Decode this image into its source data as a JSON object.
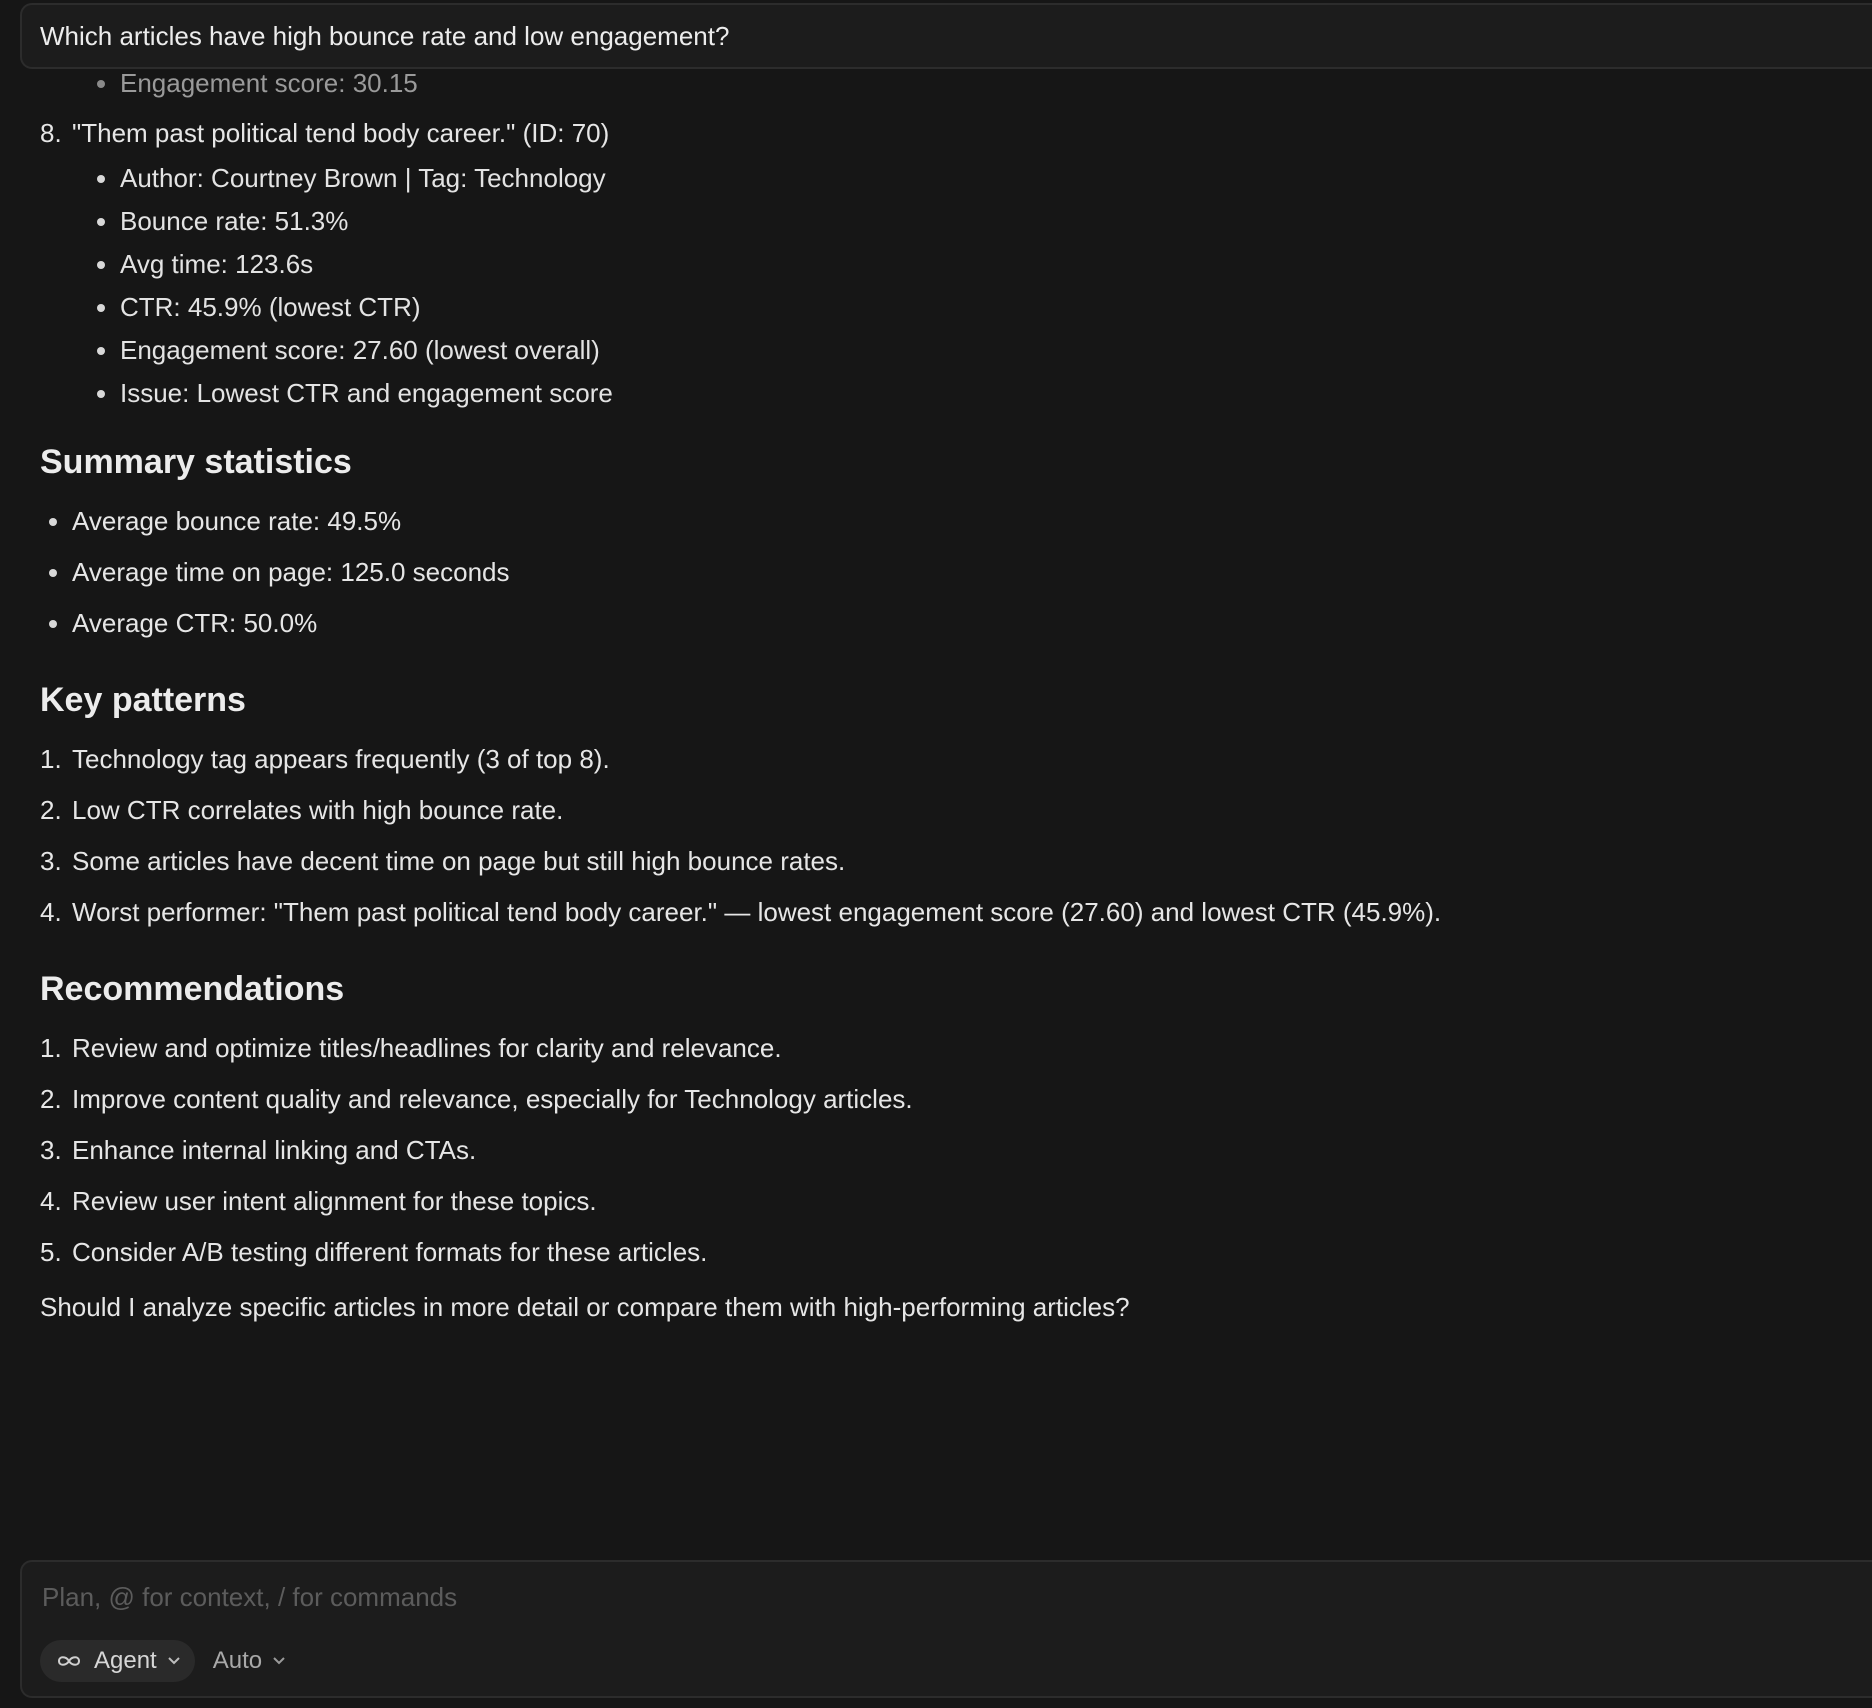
{
  "query": {
    "text": "Which articles have high bounce rate and low engagement?"
  },
  "response": {
    "prev_item_tail": "Engagement score: 30.15",
    "item8": {
      "number": "8.",
      "title": "\"Them past political tend body career.\" (ID: 70)",
      "details": [
        "Author: Courtney Brown | Tag: Technology",
        "Bounce rate: 51.3%",
        "Avg time: 123.6s",
        "CTR: 45.9% (lowest CTR)",
        "Engagement score: 27.60 (lowest overall)",
        "Issue: Lowest CTR and engagement score"
      ]
    },
    "summary": {
      "heading": "Summary statistics",
      "items": [
        "Average bounce rate: 49.5%",
        "Average time on page: 125.0 seconds",
        "Average CTR: 50.0%"
      ]
    },
    "patterns": {
      "heading": "Key patterns",
      "items": [
        {
          "num": "1.",
          "text": "Technology tag appears frequently (3 of top 8)."
        },
        {
          "num": "2.",
          "text": "Low CTR correlates with high bounce rate."
        },
        {
          "num": "3.",
          "text": "Some articles have decent time on page but still high bounce rates."
        },
        {
          "num": "4.",
          "text": "Worst performer: \"Them past political tend body career.\" — lowest engagement score (27.60) and lowest CTR (45.9%)."
        }
      ]
    },
    "recommendations": {
      "heading": "Recommendations",
      "items": [
        {
          "num": "1.",
          "text": "Review and optimize titles/headlines for clarity and relevance."
        },
        {
          "num": "2.",
          "text": "Improve content quality and relevance, especially for Technology articles."
        },
        {
          "num": "3.",
          "text": "Enhance internal linking and CTAs."
        },
        {
          "num": "4.",
          "text": "Review user intent alignment for these topics."
        },
        {
          "num": "5.",
          "text": "Consider A/B testing different formats for these articles."
        }
      ]
    },
    "closing": "Should I analyze specific articles in more detail or compare them with high-performing articles?"
  },
  "composer": {
    "placeholder": "Plan, @ for context, / for commands",
    "mode_label": "Agent",
    "mode_icon": "infinity-icon",
    "model_label": "Auto"
  }
}
